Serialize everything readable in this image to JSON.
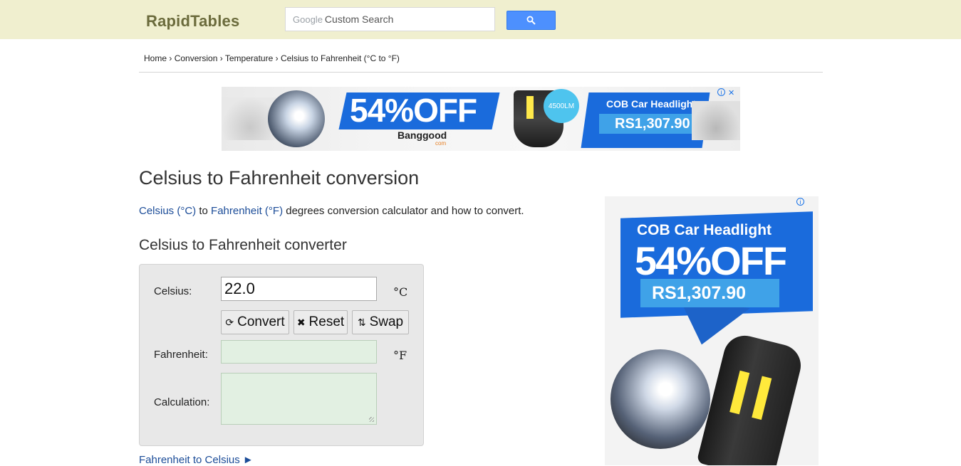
{
  "header": {
    "logo": "RapidTables",
    "search": {
      "brand": "Google",
      "placeholder": "Custom Search"
    }
  },
  "breadcrumb": {
    "items": [
      "Home",
      "Conversion",
      "Temperature",
      "Celsius to Fahrenheit (°C to °F)"
    ],
    "separator": "›"
  },
  "banner_ad": {
    "headline": "54%OFF",
    "brand": "Banggood",
    "brand_sub": "com",
    "badge": "4500LM",
    "title": "COB Car Headlight",
    "price": "RS1,307.90"
  },
  "page": {
    "title": "Celsius to Fahrenheit conversion",
    "intro": {
      "link1": "Celsius (°C)",
      "mid": " to ",
      "link2": "Fahrenheit (°F)",
      "rest": " degrees conversion calculator and how to convert."
    },
    "converter_title": "Celsius to Fahrenheit converter"
  },
  "converter": {
    "celsius_label": "Celsius:",
    "celsius_value": "22.0",
    "celsius_unit": "°C",
    "buttons": {
      "convert": "Convert",
      "reset": "Reset",
      "swap": "Swap"
    },
    "fahrenheit_label": "Fahrenheit:",
    "fahrenheit_value": "",
    "fahrenheit_unit": "°F",
    "calculation_label": "Calculation:",
    "calculation_value": ""
  },
  "next_link": "Fahrenheit to Celsius ►",
  "side_ad": {
    "title": "COB Car Headlight",
    "headline": "54%OFF",
    "price": "RS1,307.90"
  },
  "colors": {
    "topbar": "#f0efcf",
    "logo": "#6b6b3c",
    "link": "#1b4c98",
    "search_button": "#4d90fe",
    "ad_blue": "#1a6bdc",
    "output_field": "#e2f0e2"
  }
}
